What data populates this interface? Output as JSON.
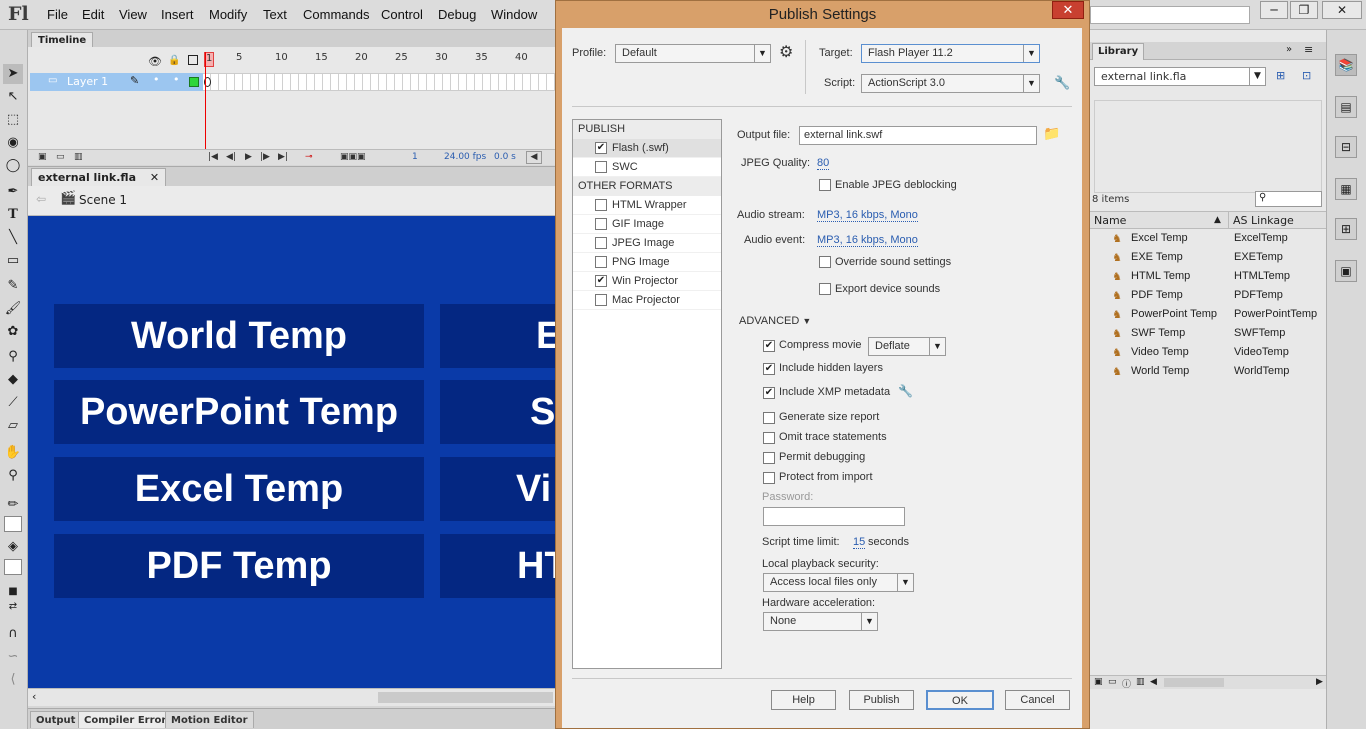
{
  "app": {
    "logo": "Fl",
    "menu": [
      "File",
      "Edit",
      "View",
      "Insert",
      "Modify",
      "Text",
      "Commands",
      "Control",
      "Debug",
      "Window"
    ],
    "window_controls": [
      "─",
      "❐",
      "✕"
    ]
  },
  "timeline": {
    "tab_label": "Timeline",
    "ruler": [
      "1",
      "5",
      "10",
      "15",
      "20",
      "25",
      "30",
      "35",
      "40"
    ],
    "layer_name": "Layer 1",
    "fps": "24.00 fps",
    "time": "0.0 s",
    "frame": "1"
  },
  "document": {
    "tab_label": "external link.fla",
    "scene": "Scene 1",
    "stage_buttons": [
      "World  Temp",
      "PowerPoint Temp",
      "Excel Temp",
      "PDF Temp",
      "E",
      "S",
      "Vi",
      "HT"
    ]
  },
  "bottom_tabs": [
    "Output",
    "Compiler Errors",
    "Motion Editor"
  ],
  "dialog": {
    "title": "Publish Settings",
    "close": "✕",
    "profile_label": "Profile:",
    "profile_value": "Default",
    "target_label": "Target:",
    "target_value": "Flash Player 11.2",
    "script_label": "Script:",
    "script_value": "ActionScript 3.0",
    "publish_header": "PUBLISH",
    "publish_items": [
      {
        "label": "Flash (.swf)",
        "checked": true
      },
      {
        "label": "SWC",
        "checked": false
      }
    ],
    "other_header": "OTHER FORMATS",
    "other_items": [
      {
        "label": "HTML Wrapper",
        "checked": false
      },
      {
        "label": "GIF Image",
        "checked": false
      },
      {
        "label": "JPEG Image",
        "checked": false
      },
      {
        "label": "PNG Image",
        "checked": false
      },
      {
        "label": "Win Projector",
        "checked": true
      },
      {
        "label": "Mac Projector",
        "checked": false
      }
    ],
    "output_file_label": "Output file:",
    "output_file": "external link.swf",
    "jpeg_quality_label": "JPEG Quality:",
    "jpeg_quality": "80",
    "jpeg_deblocking": "Enable JPEG deblocking",
    "audio_stream_label": "Audio stream:",
    "audio_stream": "MP3, 16 kbps, Mono",
    "audio_event_label": "Audio event:",
    "audio_event": "MP3, 16 kbps, Mono",
    "override_sound": "Override sound settings",
    "export_device_sounds": "Export device sounds",
    "advanced_label": "ADVANCED",
    "compress_movie": "Compress movie",
    "compress_value": "Deflate",
    "include_hidden": "Include hidden layers",
    "include_xmp": "Include XMP metadata",
    "size_report": "Generate size report",
    "omit_trace": "Omit trace statements",
    "permit_debug": "Permit debugging",
    "protect_import": "Protect from import",
    "password_label": "Password:",
    "script_time_label": "Script time limit:",
    "script_time_value": "15",
    "script_time_unit": "seconds",
    "local_playback_label": "Local playback security:",
    "local_playback_value": "Access local files only",
    "hw_accel_label": "Hardware acceleration:",
    "hw_accel_value": "None",
    "buttons": {
      "help": "Help",
      "publish": "Publish",
      "ok": "OK",
      "cancel": "Cancel"
    }
  },
  "library": {
    "tab_label": "Library",
    "file": "external link.fla",
    "count": "8 items",
    "col_name": "Name",
    "col_linkage": "AS Linkage",
    "items": [
      {
        "name": "Excel Temp",
        "linkage": "ExcelTemp"
      },
      {
        "name": "EXE Temp",
        "linkage": "EXETemp"
      },
      {
        "name": "HTML Temp",
        "linkage": "HTMLTemp"
      },
      {
        "name": "PDF Temp",
        "linkage": "PDFTemp"
      },
      {
        "name": "PowerPoint Temp",
        "linkage": "PowerPointTemp"
      },
      {
        "name": "SWF Temp",
        "linkage": "SWFTemp"
      },
      {
        "name": "Video Temp",
        "linkage": "VideoTemp"
      },
      {
        "name": "World  Temp",
        "linkage": "WorldTemp"
      }
    ]
  }
}
